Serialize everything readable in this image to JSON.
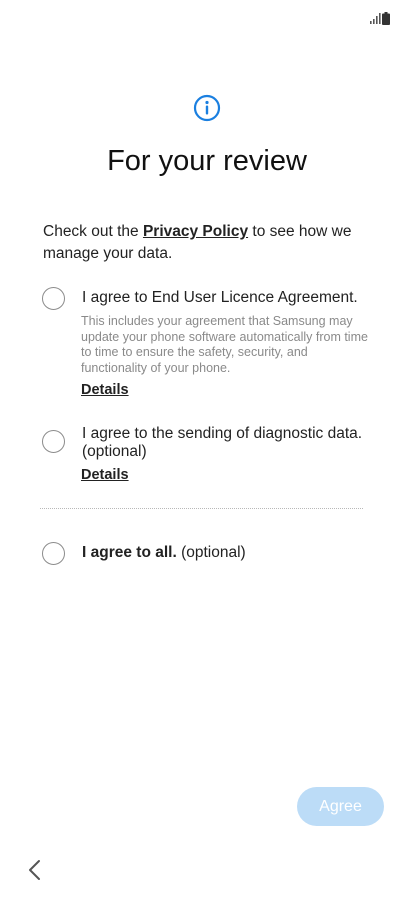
{
  "status_bar": {
    "signal_icon": "signal-icon",
    "battery_icon": "battery-icon"
  },
  "header": {
    "icon": "info-icon",
    "title": "For your review",
    "accent_color": "#1a7fe0"
  },
  "intro": {
    "prefix": "Check out the ",
    "privacy_link": "Privacy Policy",
    "suffix": " to see how we manage your data."
  },
  "options": [
    {
      "label": "I agree to End User Licence Agreement.",
      "description": "This includes your agreement that Samsung may update your phone software automatically from time to time to ensure the safety, security, and functionality of your phone.",
      "details": "Details",
      "checked": false
    },
    {
      "label": "I agree to the sending of diagnostic data. (optional)",
      "details": "Details",
      "checked": false
    }
  ],
  "agree_all": {
    "bold": "I agree to all.",
    "rest": " (optional)",
    "checked": false
  },
  "footer": {
    "agree_label": "Agree",
    "agree_enabled": false,
    "back_icon": "chevron-left-icon"
  }
}
